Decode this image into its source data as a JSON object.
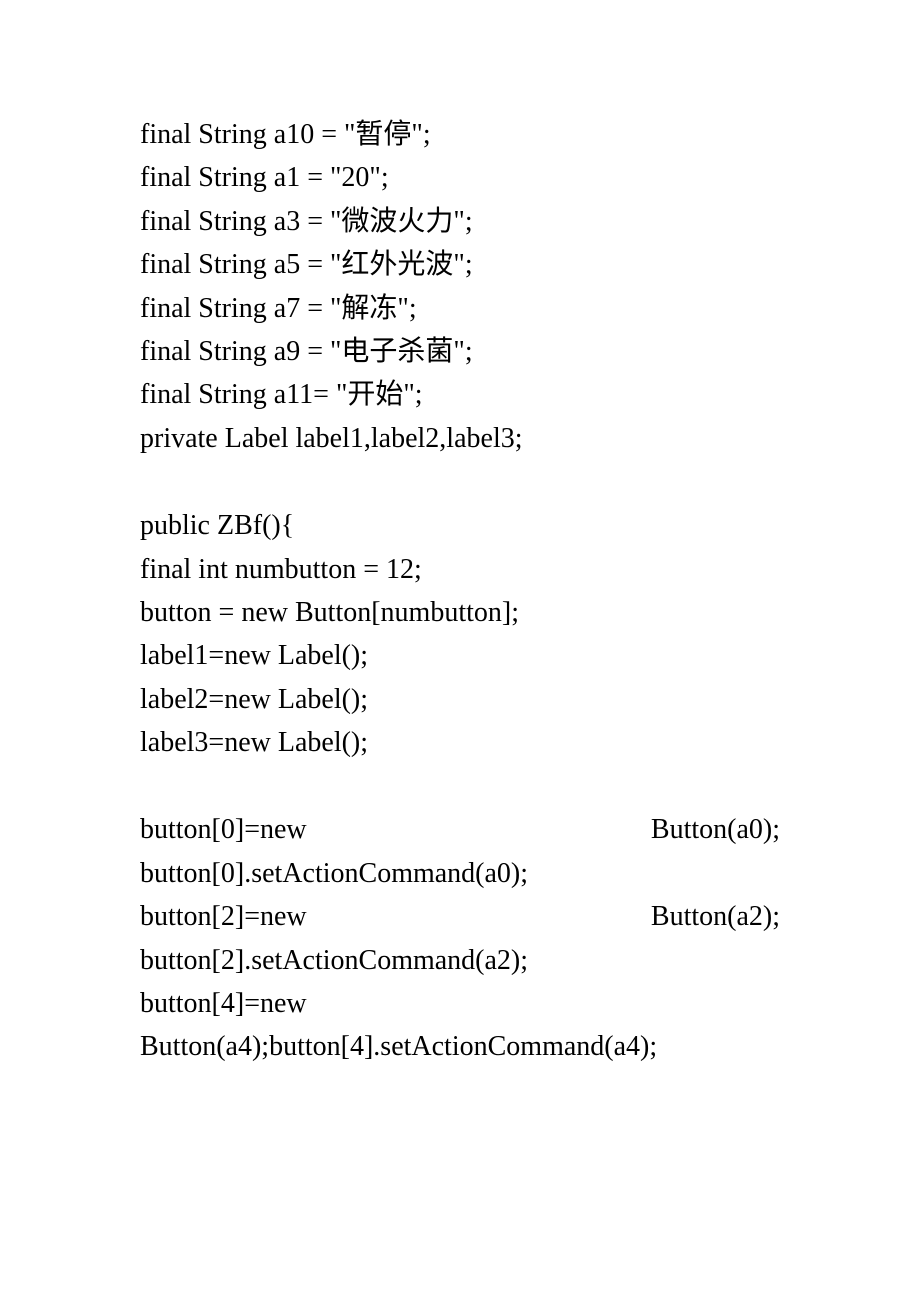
{
  "lines": {
    "l1": "final String a10 = \"暂停\";",
    "l2": "final String a1 = \"20\";",
    "l3": "final String a3 = \"微波火力\";",
    "l4": "final String a5 = \"红外光波\";",
    "l5": "final String a7 = \"解冻\";",
    "l6": "final String a9 = \"电子杀菌\";",
    "l7": "final String a11= \"开始\";",
    "l8": "  private    Label label1,label2,label3;",
    "l9": "  public ZBf(){",
    "l10": "final int numbutton = 12;",
    "l11": "button = new Button[numbutton];",
    "l12": "label1=new Label();",
    "l13": "label2=new Label();",
    "l14": "label3=new Label();",
    "l15a": "  button[0]=new",
    "l15b": "Button(a0);",
    "l16": "button[0].setActionCommand(a0);",
    "l17a": "  button[2]=new",
    "l17b": "Button(a2);",
    "l18": "button[2].setActionCommand(a2);",
    "l19": "  button[4]=new",
    "l20": "Button(a4);button[4].setActionCommand(a4);"
  }
}
